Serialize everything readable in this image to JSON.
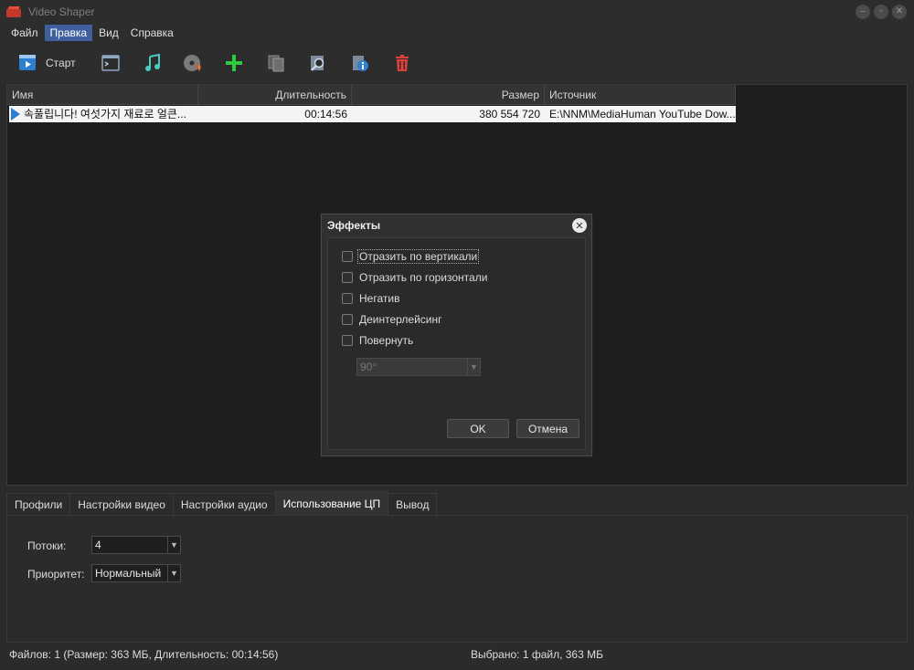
{
  "window": {
    "title": "Video Shaper"
  },
  "menu": [
    "Файл",
    "Правка",
    "Вид",
    "Справка"
  ],
  "toolbar": {
    "start_label": "Старт",
    "icons": [
      "play-clip-icon",
      "console-icon",
      "music-note-icon",
      "disc-burn-icon",
      "add-icon",
      "copy-icon",
      "zoom-icon",
      "info-icon",
      "delete-icon"
    ]
  },
  "list": {
    "columns": [
      "Имя",
      "Длительность",
      "Размер",
      "Источник"
    ],
    "rows": [
      {
        "name": "속풀립니다! 여섯가지 재료로 얼큰...",
        "duration": "00:14:56",
        "size": "380 554 720",
        "source": "E:\\NNM\\MediaHuman YouTube Dow..."
      }
    ]
  },
  "dialog": {
    "title": "Эффекты",
    "options": [
      "Отразить по вертикали",
      "Отразить по горизонтали",
      "Негатив",
      "Деинтерлейсинг",
      "Повернуть"
    ],
    "rotate_value": "90°",
    "ok_label": "OK",
    "cancel_label": "Отмена"
  },
  "tabs": [
    "Профили",
    "Настройки видео",
    "Настройки аудио",
    "Использование ЦП",
    "Вывод"
  ],
  "cpu": {
    "threads_label": "Потоки:",
    "threads_value": "4",
    "priority_label": "Приоритет:",
    "priority_value": "Нормальный"
  },
  "status": {
    "left": "Файлов: 1 (Размер: 363 МБ, Длительность: 00:14:56)",
    "right": "Выбрано: 1 файл, 363 МБ"
  },
  "colors": {
    "accent": "#3f5f9f",
    "add": "#2ecc40",
    "delete": "#e0403a",
    "music": "#4ac9c0"
  }
}
